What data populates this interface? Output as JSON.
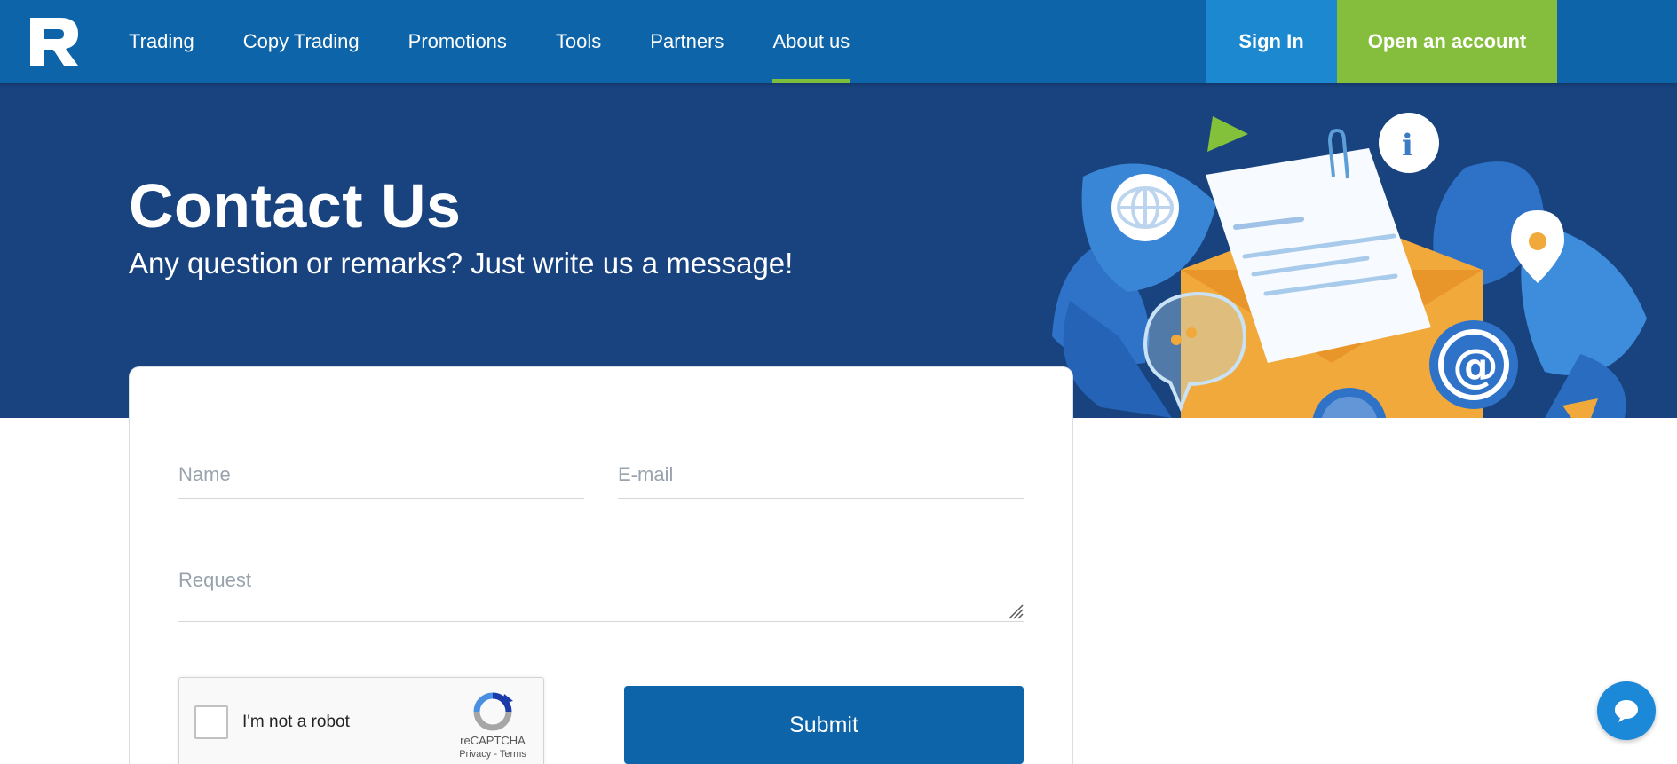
{
  "header": {
    "logo_icon": "roboforex-logo-icon",
    "nav": [
      {
        "label": "Trading",
        "active": false
      },
      {
        "label": "Copy Trading",
        "active": false
      },
      {
        "label": "Promotions",
        "active": false
      },
      {
        "label": "Tools",
        "active": false
      },
      {
        "label": "Partners",
        "active": false
      },
      {
        "label": "About us",
        "active": true
      }
    ],
    "signin_label": "Sign In",
    "open_account_label": "Open an account"
  },
  "hero": {
    "title": "Contact Us",
    "subtitle": "Any question or remarks? Just write us a message!",
    "illustration_icon": "envelope-illustration"
  },
  "form": {
    "name_placeholder": "Name",
    "email_placeholder": "E-mail",
    "request_placeholder": "Request",
    "captcha_label": "I'm not a robot",
    "captcha_brand": "reCAPTCHA",
    "captcha_links": "Privacy - Terms",
    "submit_label": "Submit"
  },
  "chat": {
    "icon": "chat-bubble-icon"
  },
  "colors": {
    "header_bg": "#0e64a8",
    "hero_bg": "#18437f",
    "signin_bg": "#1b88cf",
    "open_account_bg": "#85bd3c",
    "active_underline": "#7cbf3c",
    "submit_bg": "#0e64a8",
    "chat_bg": "#1b88d8"
  }
}
